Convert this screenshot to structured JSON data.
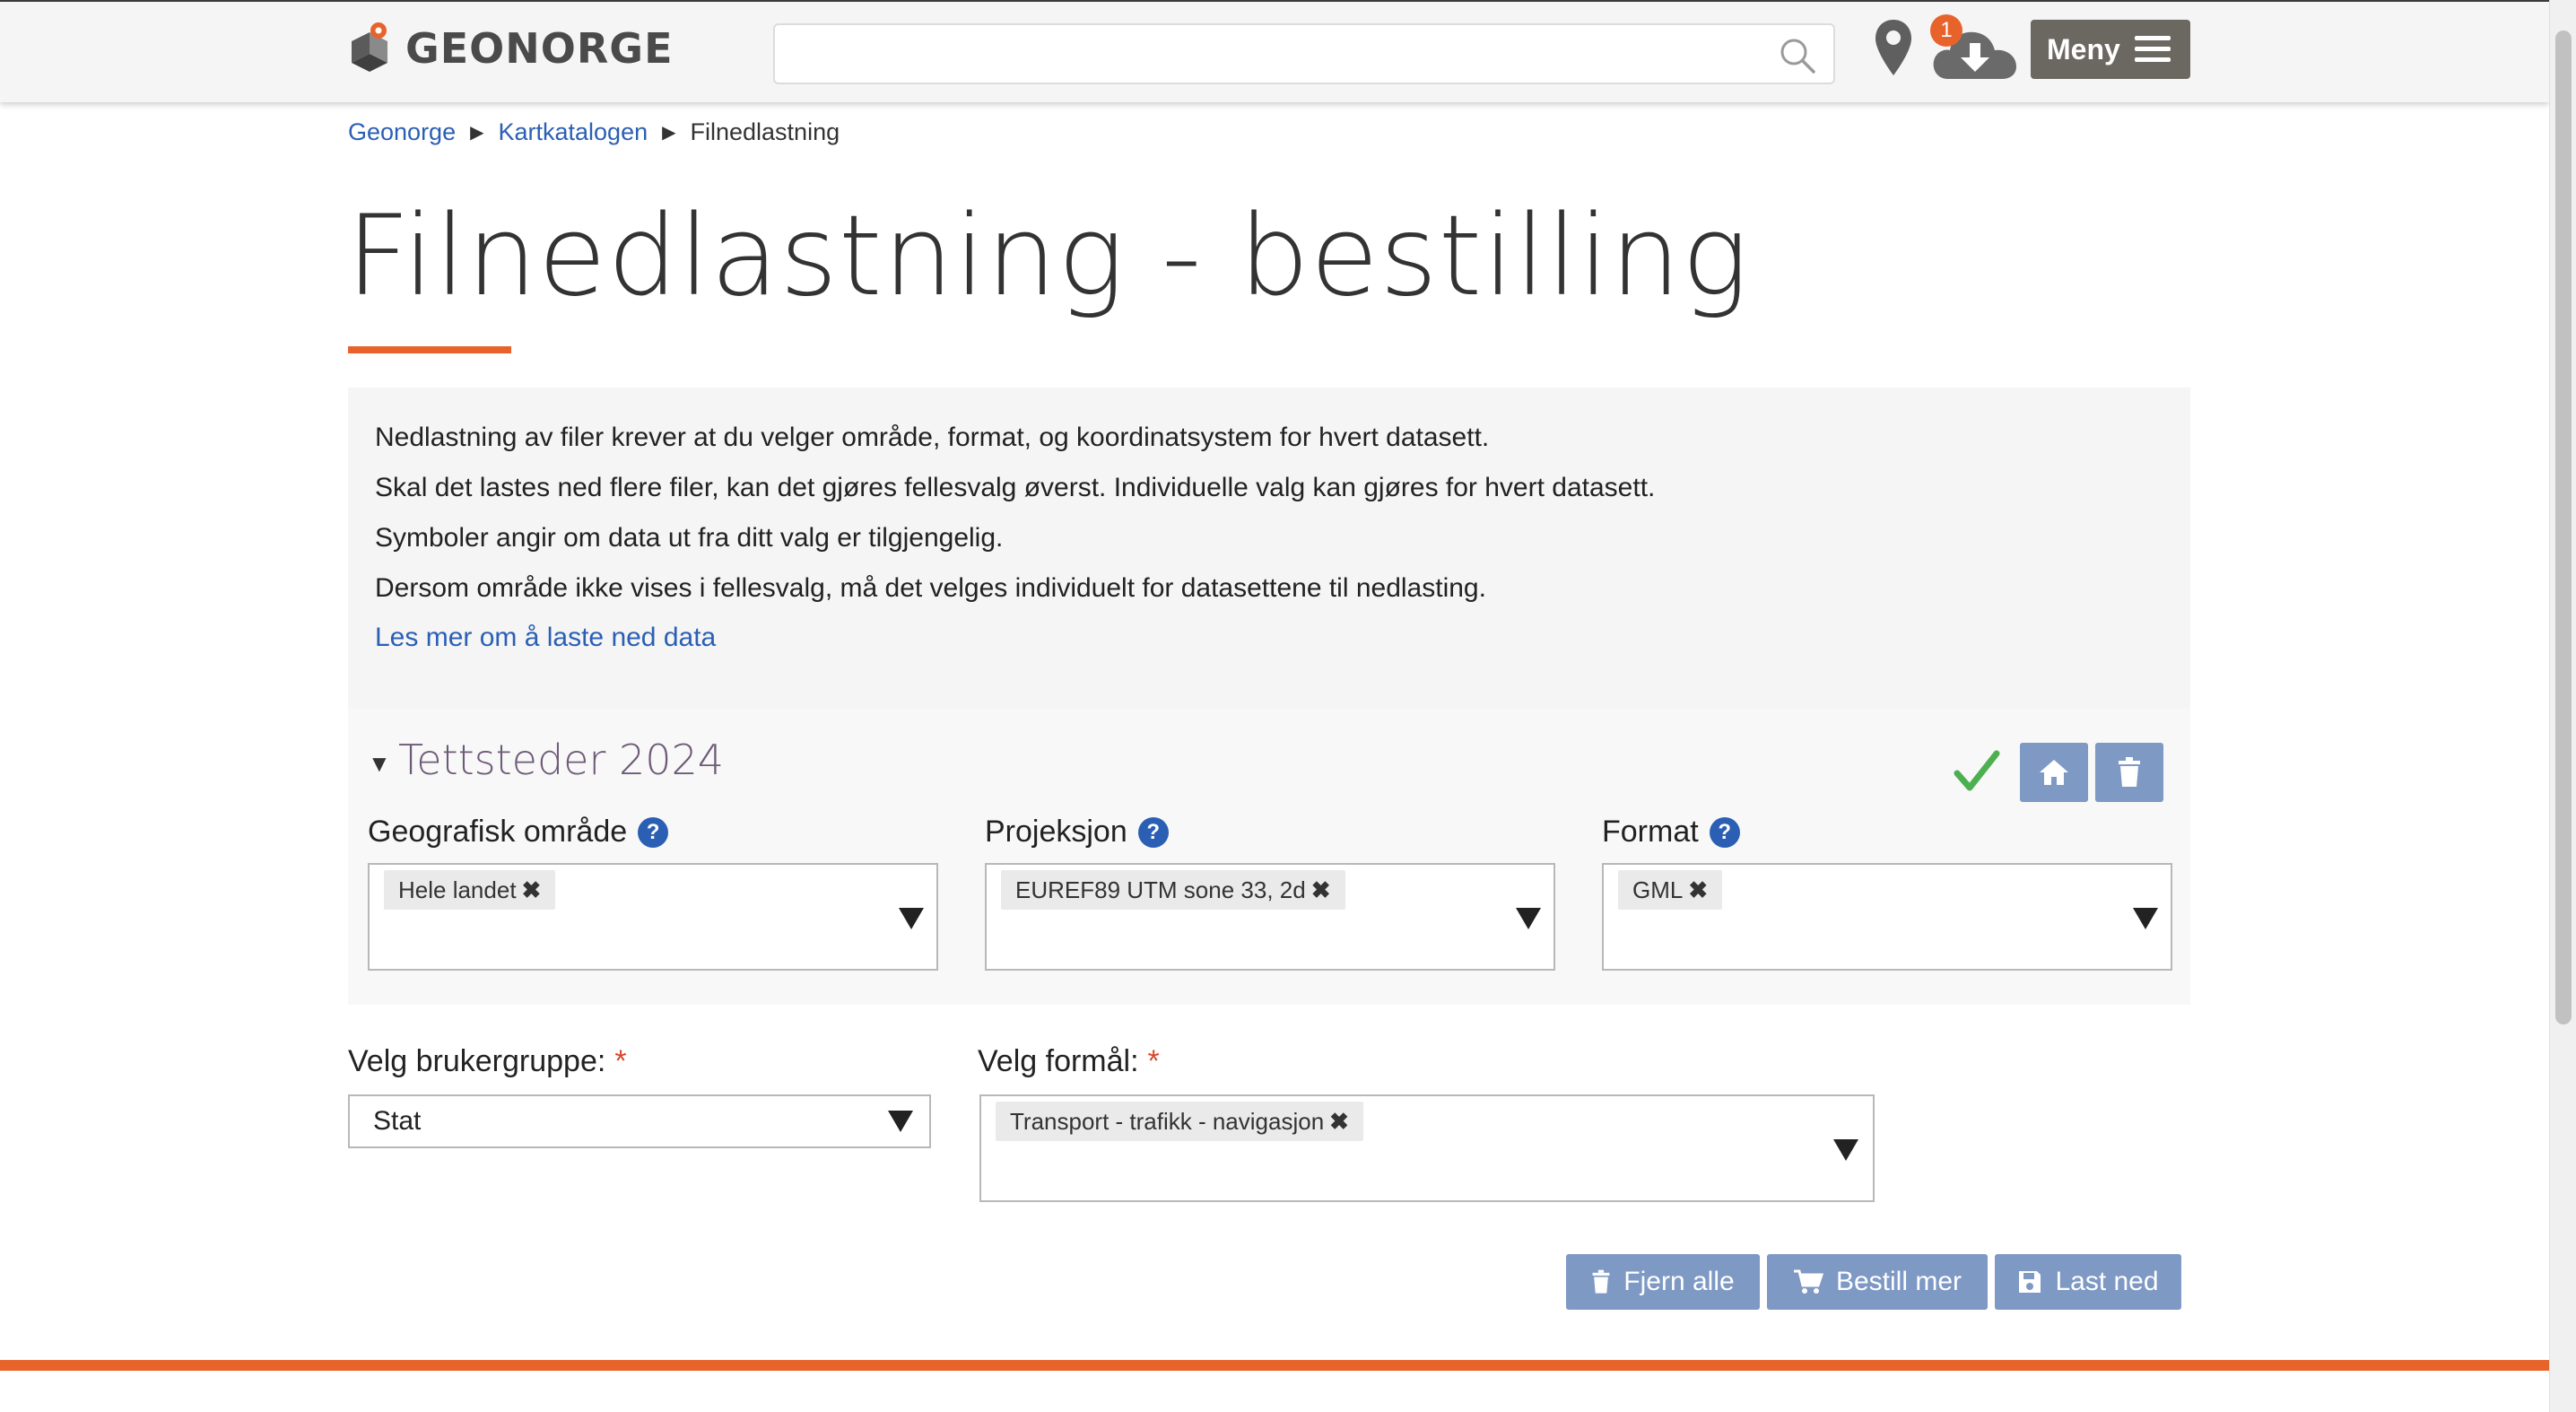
{
  "header": {
    "logo_text": "GEONORGE",
    "search_placeholder": "",
    "download_count": "1",
    "menu_label": "Meny"
  },
  "breadcrumb": {
    "items": [
      "Geonorge",
      "Kartkatalogen"
    ],
    "current": "Filnedlastning"
  },
  "page": {
    "title": "Filnedlastning - bestilling"
  },
  "info": {
    "lines": [
      "Nedlastning av filer krever at du velger område, format, og koordinatsystem for hvert datasett.",
      "Skal det lastes ned flere filer, kan det gjøres fellesvalg øverst. Individuelle valg kan gjøres for hvert datasett.",
      "Symboler angir om data ut fra ditt valg er tilgjengelig.",
      "Dersom område ikke vises i fellesvalg, må det velges individuelt for datasettene til nedlasting."
    ],
    "read_more_link": "Les mer om å laste ned data"
  },
  "dataset": {
    "title": "Tettsteder 2024",
    "fields": [
      {
        "label": "Geografisk område",
        "help": "?",
        "chip": "Hele landet"
      },
      {
        "label": "Projeksjon",
        "help": "?",
        "chip": "EUREF89 UTM sone 33, 2d"
      },
      {
        "label": "Format",
        "help": "?",
        "chip": "GML"
      }
    ],
    "status_color": "#4caf50"
  },
  "order": {
    "usergroup_label": "Velg brukergruppe:",
    "usergroup_value": "Stat",
    "purpose_label": "Velg formål:",
    "purpose_chip": "Transport - trafikk - navigasjon",
    "required_mark": "*"
  },
  "actions": {
    "remove_all": "Fjern alle",
    "order_more": "Bestill mer",
    "download": "Last ned"
  },
  "colors": {
    "accent": "#e8632c",
    "link": "#2b5fb4",
    "button": "#7d99c4"
  }
}
